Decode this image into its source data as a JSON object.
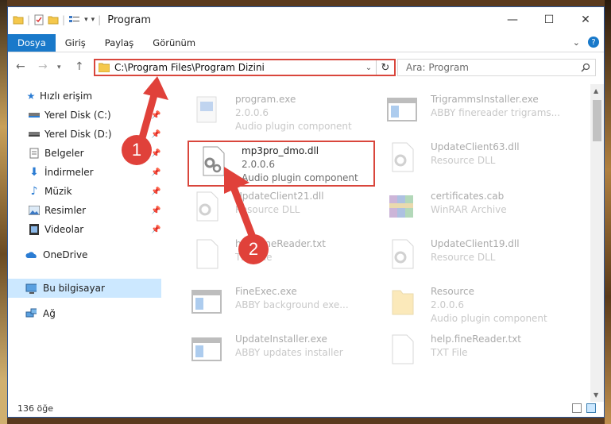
{
  "window": {
    "title": "Program",
    "controls": [
      "minimize-icon",
      "maximize-icon",
      "close-icon"
    ]
  },
  "ribbon": {
    "tabs": [
      {
        "label": "Dosya",
        "active": true
      },
      {
        "label": "Giriş",
        "active": false
      },
      {
        "label": "Paylaş",
        "active": false
      },
      {
        "label": "Görünüm",
        "active": false
      }
    ],
    "help_label": "?"
  },
  "navbar": {
    "path": "C:\\Program Files\\Program Dizini",
    "search_placeholder": "Ara: Program"
  },
  "navpane": {
    "items": [
      {
        "label": "Hızlı erişim",
        "icon": "star-icon",
        "pinned": false
      },
      {
        "label": "Yerel Disk (C:)",
        "icon": "drive-icon",
        "pinned": true
      },
      {
        "label": "Yerel Disk (D:)",
        "icon": "drive-icon",
        "pinned": true
      },
      {
        "label": "Belgeler",
        "icon": "documents-icon",
        "pinned": true
      },
      {
        "label": "İndirmeler",
        "icon": "downloads-icon",
        "pinned": true
      },
      {
        "label": "Müzik",
        "icon": "music-icon",
        "pinned": true
      },
      {
        "label": "Resimler",
        "icon": "pictures-icon",
        "pinned": true
      },
      {
        "label": "Videolar",
        "icon": "videos-icon",
        "pinned": true
      },
      {
        "label": "OneDrive",
        "icon": "onedrive-icon",
        "pinned": false
      },
      {
        "label": "Bu bilgisayar",
        "icon": "computer-icon",
        "pinned": false,
        "selected": true
      },
      {
        "label": "Ağ",
        "icon": "network-icon",
        "pinned": false
      }
    ]
  },
  "files": [
    {
      "name": "program.exe",
      "line2": "2.0.0.6",
      "line3": "Audio plugin component",
      "icon": "exe-icon"
    },
    {
      "name": "TrigrammsInstaller.exe",
      "line2": "ABBY finereader trigrams...",
      "line3": "",
      "icon": "window-exe-icon"
    },
    {
      "name": "mp3pro_dmo.dll",
      "line2": "2.0.0.6",
      "line3": "Audio plugin component",
      "icon": "dll-gear-icon",
      "highlighted": true
    },
    {
      "name": "UpdateClient63.dll",
      "line2": "Resource DLL",
      "line3": "",
      "icon": "dll-gear-icon"
    },
    {
      "name": "UpdateClient21.dll",
      "line2": "Resource DLL",
      "line3": "",
      "icon": "dll-gear-icon"
    },
    {
      "name": "certificates.cab",
      "line2": "WinRAR Archive",
      "line3": "",
      "icon": "winrar-icon"
    },
    {
      "name": "help.fineReader.txt",
      "line2": "TXT File",
      "line3": "",
      "icon": "txt-icon"
    },
    {
      "name": "UpdateClient19.dll",
      "line2": "Resource DLL",
      "line3": "",
      "icon": "dll-gear-icon"
    },
    {
      "name": "FineExec.exe",
      "line2": "ABBY background exe...",
      "line3": "",
      "icon": "window-exe-icon"
    },
    {
      "name": "Resource",
      "line2": "2.0.0.6",
      "line3": "Audio plugin component",
      "icon": "folder-icon"
    },
    {
      "name": "UpdateInstaller.exe",
      "line2": "ABBY updates installer",
      "line3": "",
      "icon": "window-exe-icon"
    },
    {
      "name": "help.fineReader.txt",
      "line2": "TXT File",
      "line3": "",
      "icon": "txt-icon"
    }
  ],
  "status": {
    "count": "136 öğe"
  },
  "annotations": {
    "step1": "1",
    "step2": "2",
    "color": "#e0413a"
  }
}
